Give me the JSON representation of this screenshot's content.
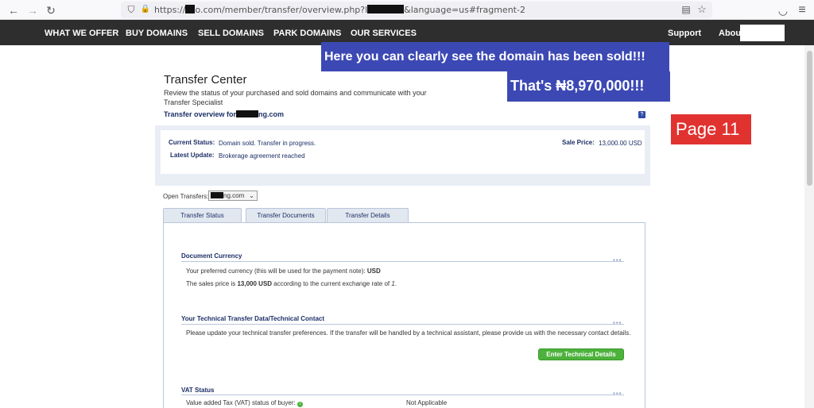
{
  "browser": {
    "url_prefix": "https://",
    "url_mid": "o.com/member/transfer/overview.php?l",
    "url_suffix": "&language=us#fragment-2",
    "back": "←",
    "forward": "→",
    "reload": "↻",
    "shield": "⛉",
    "lock": "🔒",
    "reader": "▤",
    "star": "☆",
    "pocket": "◡",
    "menu": "≡"
  },
  "nav": {
    "items": [
      "WHAT WE OFFER",
      "BUY DOMAINS",
      "SELL DOMAINS",
      "PARK DOMAINS",
      "OUR SERVICES"
    ],
    "support": "Support",
    "about": "About"
  },
  "overlays": {
    "sold_note": "Here you can clearly see the domain has been sold!!!",
    "price_note": "That's ₦8,970,000!!!",
    "page_label": "Page 11"
  },
  "header": {
    "title": "Transfer Center",
    "subtitle": "Review the status of your purchased and sold domains and communicate with your Transfer Specialist",
    "overview_prefix": "Transfer overview for",
    "overview_suffix": "ng.com",
    "help": "?"
  },
  "status": {
    "current_label": "Current Status:",
    "current_value": "Domain sold. Transfer in progress.",
    "latest_label": "Latest Update:",
    "latest_value": "Brokerage agreement reached",
    "price_label": "Sale Price:",
    "price_value": "13,000.00 USD"
  },
  "open_transfers": {
    "label": "Open Transfers:",
    "selected_suffix": "ng.com"
  },
  "tabs": [
    "Transfer Status",
    "Transfer Documents",
    "Transfer Details"
  ],
  "sections": {
    "currency_title": "Document Currency",
    "currency_line1_prefix": "Your preferred currency (this will be used for the payment note): ",
    "currency_line1_value": "USD",
    "currency_line2_a": "The sales price is ",
    "currency_line2_b": "13,000 USD",
    "currency_line2_c": " according to the current exchange rate of ",
    "currency_line2_d": "1",
    "currency_line2_e": ".",
    "tech_title": "Your Technical Transfer Data/Technical Contact",
    "tech_text": "Please update your technical transfer preferences. If the transfer will be handled by a technical assistant, please provide us with the necessary contact details.",
    "tech_button": "Enter Technical Details",
    "vat_title": "VAT Status",
    "vat_label": "Value added Tax (VAT) status of buyer:",
    "vat_value": "Not Applicable",
    "dots": "▪▪▪"
  }
}
